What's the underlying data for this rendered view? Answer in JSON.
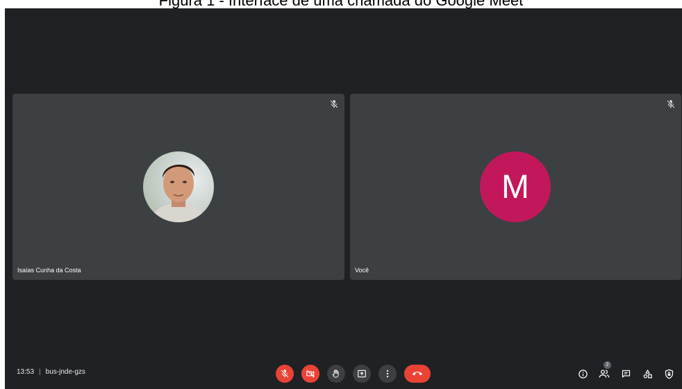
{
  "caption": "Figura 1 - Interface de uma chamada do Google Meet",
  "participants": [
    {
      "name": "Isaías Cunha da Costa",
      "avatar": "photo-avatar",
      "muted": true
    },
    {
      "name": "Você",
      "initial": "M",
      "avatar_color": "#c2185b",
      "muted": true
    }
  ],
  "meeting": {
    "time": "13:53",
    "separator": "|",
    "code": "bus-jnde-gzs"
  },
  "controls": [
    "mic-off-icon",
    "camera-off-icon",
    "raise-hand-icon",
    "present-screen-icon",
    "more-options-icon",
    "end-call-icon"
  ],
  "right_panel": {
    "people_count": "2",
    "icons": [
      "info-icon",
      "people-icon",
      "chat-icon",
      "activities-icon",
      "host-controls-icon"
    ]
  },
  "colors": {
    "background": "#202124",
    "tile": "#3c4043",
    "danger": "#ea4335",
    "avatar": "#c2185b"
  }
}
